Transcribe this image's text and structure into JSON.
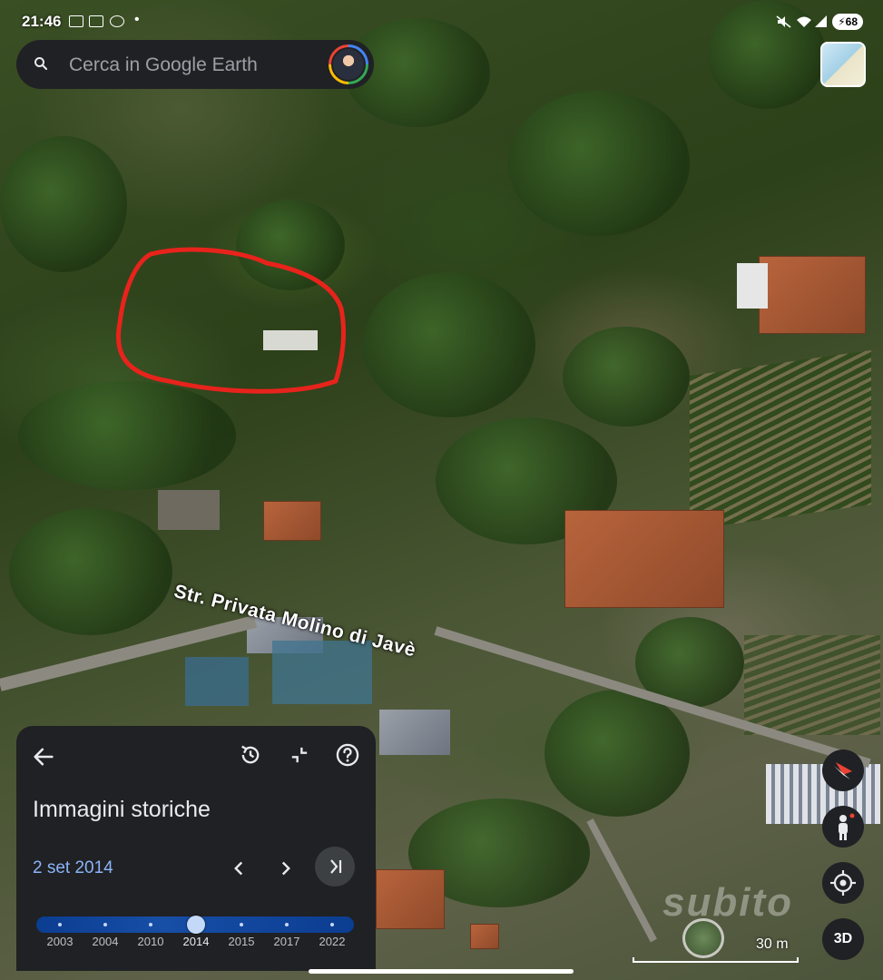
{
  "status_bar": {
    "time": "21:46",
    "battery": "68"
  },
  "search": {
    "placeholder": "Cerca in Google Earth"
  },
  "map": {
    "road_label": "Str. Privata Molino di Javè",
    "scale_label": "30 m",
    "watermark": "subito"
  },
  "controls": {
    "three_d_label": "3D"
  },
  "history_panel": {
    "title": "Immagini storiche",
    "current_date": "2 set 2014",
    "years": [
      "2003",
      "2004",
      "2010",
      "2014",
      "2015",
      "2017",
      "2022"
    ],
    "selected_year": "2014"
  },
  "colors": {
    "accent": "#8ab4f8",
    "panel_bg": "#202124",
    "outline_red": "#e8231c"
  },
  "icons": [
    "search-icon",
    "back-arrow-icon",
    "history-icon",
    "collapse-icon",
    "help-icon",
    "chevron-left-icon",
    "chevron-right-icon",
    "skip-to-latest-icon",
    "compass-icon",
    "pegman-icon",
    "my-location-icon"
  ]
}
